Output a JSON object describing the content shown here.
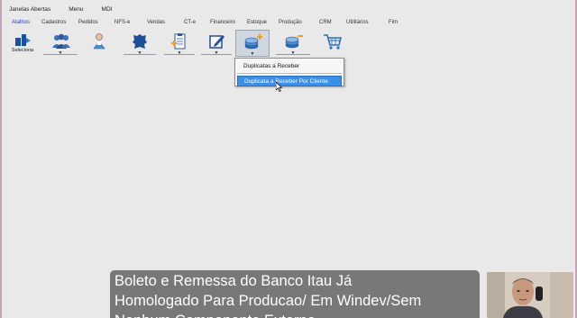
{
  "menubar": {
    "items": [
      "Janelas Abertas",
      "Menu",
      "MDI"
    ]
  },
  "tabs": [
    "Atalhos",
    "Cadastros",
    "Pedidos",
    "NFS-e",
    "Vendas",
    "CT-e",
    "Financeiro",
    "Estoque",
    "Produção",
    "CRM",
    "Utilitários",
    "Fim"
  ],
  "toolbar": {
    "first_label": "Seleciona",
    "buttons": [
      "sair-icon",
      "users-icon",
      "person-icon",
      "leather-icon",
      "clipboard-icon",
      "edit-icon",
      "coins-plus-icon",
      "coins-minus-icon",
      "cart-icon"
    ]
  },
  "dropdown": {
    "item1": "Duplicatas a Receber",
    "item2": "Duplicata a Receber Por Cliente"
  },
  "caption": {
    "line1": "Boleto e Remessa do Banco Itau Já",
    "line2": "Homologado Para Producao/ Em Windev/Sem",
    "line3": "Nenhum Componente Externo"
  },
  "colors": {
    "accent": "#3b8fe8",
    "active_tab": "#2040c0"
  }
}
